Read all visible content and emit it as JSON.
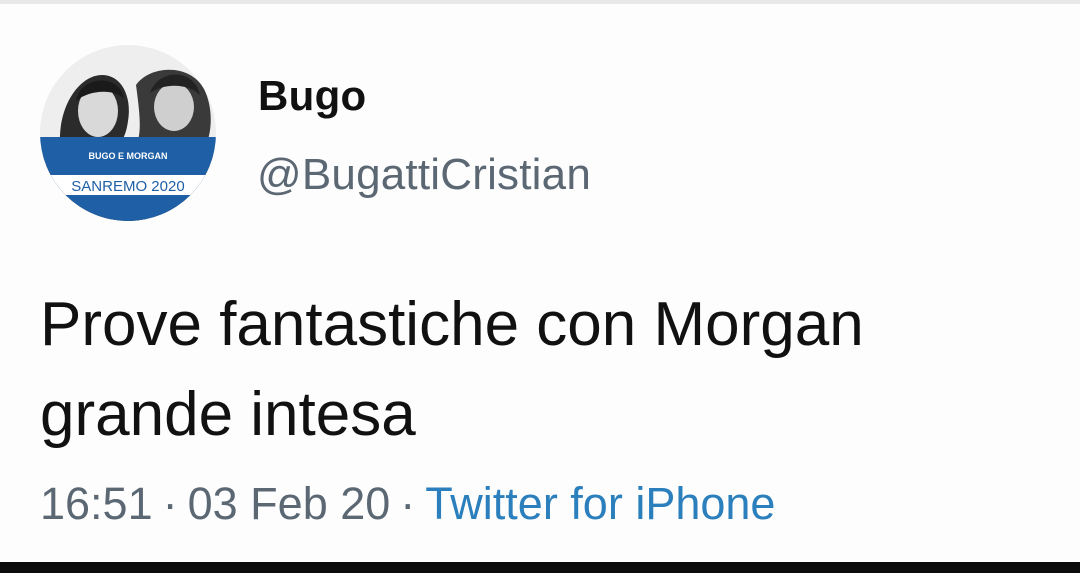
{
  "tweet": {
    "display_name": "Bugo",
    "handle": "@BugattiCristian",
    "text_line_1": "Prove fantastiche con Morgan",
    "text_line_2": "grande intesa",
    "time": "16:51",
    "date": "03 Feb 20",
    "separator": "·",
    "source": "Twitter for iPhone"
  },
  "avatar": {
    "icon": "profile-avatar",
    "banner_line_1": "BUGO E MORGAN",
    "banner_line_2": "SANREMO 2020",
    "banner_color": "#1f5fa6"
  },
  "colors": {
    "text": "#111111",
    "secondary": "#5b6874",
    "link": "#2a7fbc"
  }
}
